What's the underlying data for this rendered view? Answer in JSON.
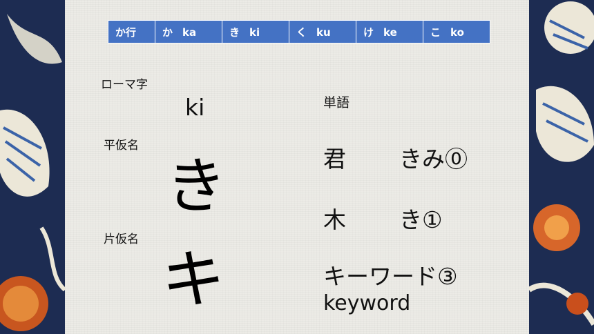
{
  "header_row": [
    {
      "kana": "か行",
      "romaji": ""
    },
    {
      "kana": "か",
      "romaji": "ka"
    },
    {
      "kana": "き",
      "romaji": "ki"
    },
    {
      "kana": "く",
      "romaji": "ku"
    },
    {
      "kana": "け",
      "romaji": "ke"
    },
    {
      "kana": "こ",
      "romaji": "ko"
    }
  ],
  "labels": {
    "romaji": "ローマ字",
    "hiragana": "平仮名",
    "katakana": "片仮名",
    "vocab": "単語"
  },
  "character": {
    "romaji": "ki",
    "hiragana": "き",
    "katakana": "キ"
  },
  "vocabulary": [
    {
      "word": "君",
      "reading": "きみ⓪"
    },
    {
      "word": "木",
      "reading": "き①"
    },
    {
      "word": "キーワード③",
      "reading": "keyword"
    }
  ],
  "colors": {
    "header_bg": "#4472c4",
    "slide_bg": "#ecebe6",
    "border_bg": "#1d2c52"
  }
}
